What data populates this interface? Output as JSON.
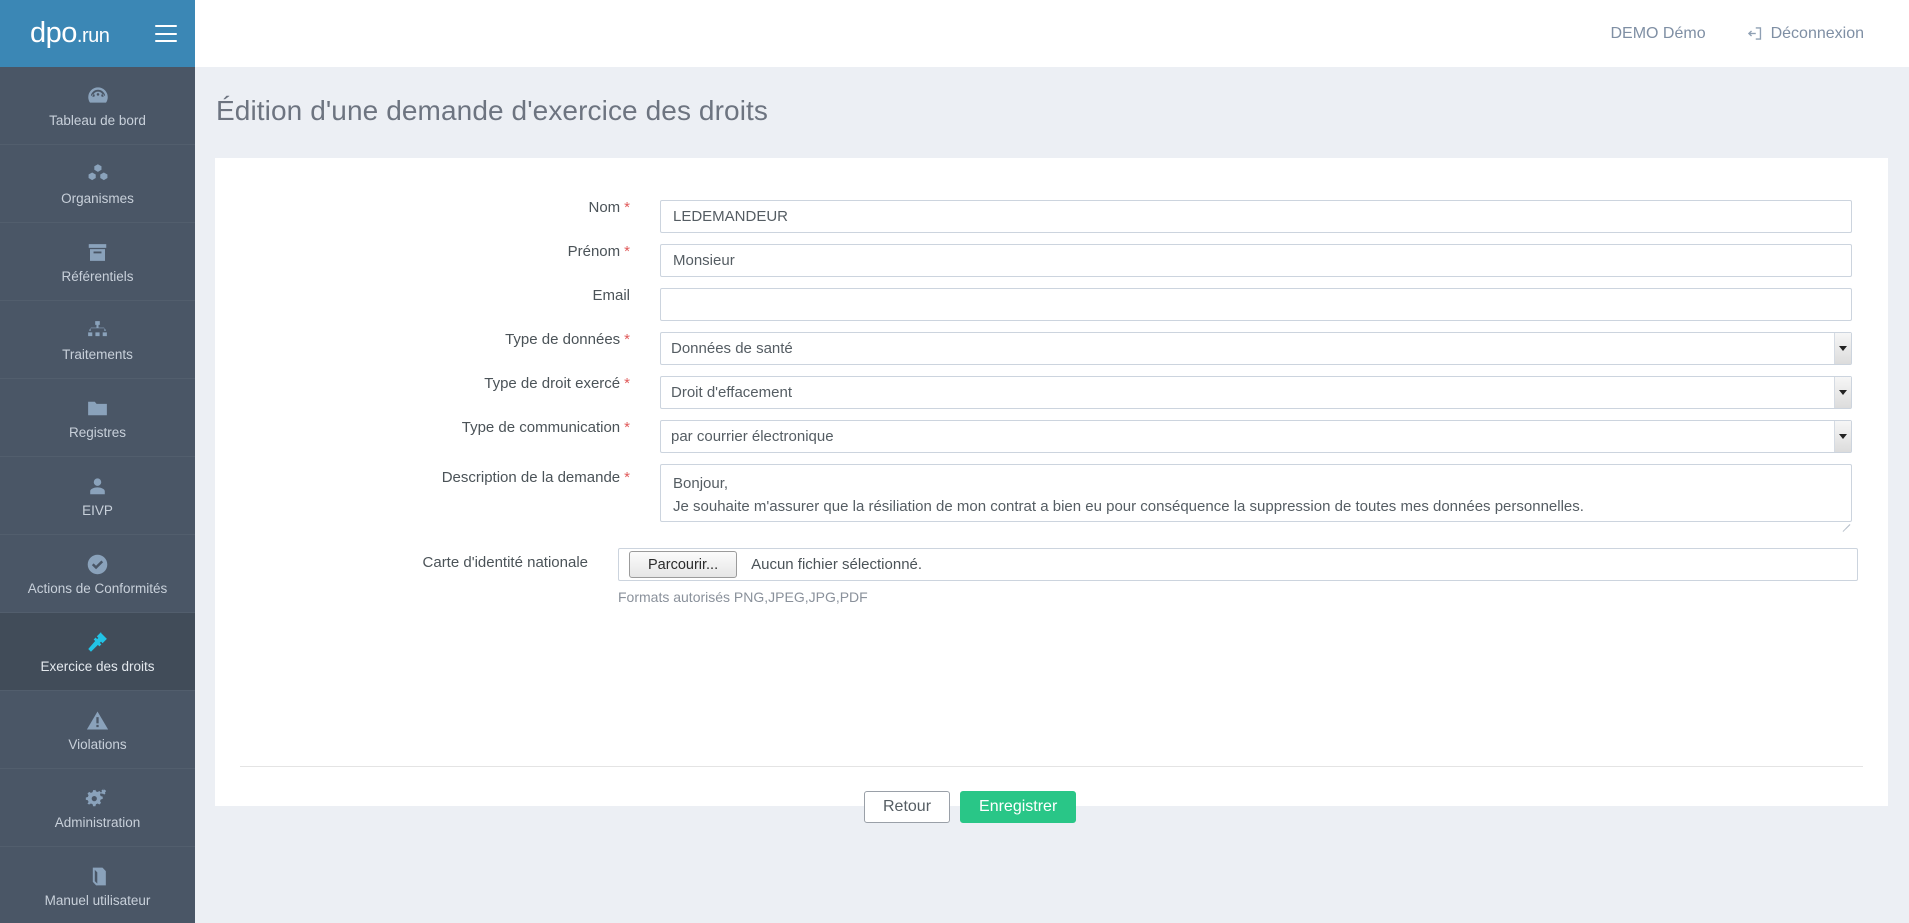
{
  "brand": {
    "logo_main": "dpo",
    "logo_suffix": ".run",
    "menu_icon": "hamburger-icon"
  },
  "topbar": {
    "user": "DEMO Démo",
    "logout_label": "Déconnexion",
    "logout_icon": "sign-out-icon"
  },
  "sidebar": {
    "items": [
      {
        "label": "Tableau de bord",
        "icon": "dashboard-gauge-icon",
        "active": false
      },
      {
        "label": "Organismes",
        "icon": "cubes-icon",
        "active": false
      },
      {
        "label": "Référentiels",
        "icon": "archive-box-icon",
        "active": false
      },
      {
        "label": "Traitements",
        "icon": "sitemap-icon",
        "active": false
      },
      {
        "label": "Registres",
        "icon": "folder-icon",
        "active": false
      },
      {
        "label": "EIVP",
        "icon": "user-icon",
        "active": false
      },
      {
        "label": "Actions de Conformités",
        "icon": "check-circle-icon",
        "active": false
      },
      {
        "label": "Exercice des droits",
        "icon": "gavel-icon",
        "active": true
      },
      {
        "label": "Violations",
        "icon": "warning-triangle-icon",
        "active": false
      },
      {
        "label": "Administration",
        "icon": "gears-icon",
        "active": false
      },
      {
        "label": "Manuel utilisateur",
        "icon": "book-icon",
        "active": false
      }
    ]
  },
  "page": {
    "title": "Édition d'une demande d'exercice des droits"
  },
  "form": {
    "nom": {
      "label": "Nom",
      "required": true,
      "value": "LEDEMANDEUR",
      "placeholder": ""
    },
    "prenom": {
      "label": "Prénom",
      "required": true,
      "value": "Monsieur",
      "placeholder": ""
    },
    "email": {
      "label": "Email",
      "required": false,
      "value": "",
      "placeholder": ""
    },
    "type_donnees": {
      "label": "Type de données",
      "required": true,
      "value": "Données de santé",
      "options": [
        "Données de santé"
      ]
    },
    "type_droit": {
      "label": "Type de droit exercé",
      "required": true,
      "value": "Droit d'effacement",
      "options": [
        "Droit d'effacement"
      ]
    },
    "type_communication": {
      "label": "Type de communication",
      "required": true,
      "value": "par courrier électronique",
      "options": [
        "par courrier électronique"
      ]
    },
    "description": {
      "label": "Description de la demande",
      "required": true,
      "value": "Bonjour,\nJe souhaite m'assurer que la résiliation de mon contrat a bien eu pour conséquence la suppression de toutes mes données personnelles."
    },
    "carte_identite": {
      "label": "Carte d'identité nationale",
      "required": false,
      "browse_label": "Parcourir...",
      "file_status": "Aucun fichier sélectionné.",
      "hint": "Formats autorisés PNG,JPEG,JPG,PDF"
    }
  },
  "actions": {
    "back_label": "Retour",
    "save_label": "Enregistrer"
  },
  "colors": {
    "brand_blue": "#3b87b5",
    "sidebar": "#4a5666",
    "sidebar_active": "#414c59",
    "accent_cyan": "#22c3e6",
    "save_green": "#29c687",
    "required_red": "#e05a5a",
    "content_bg": "#eceff4"
  }
}
